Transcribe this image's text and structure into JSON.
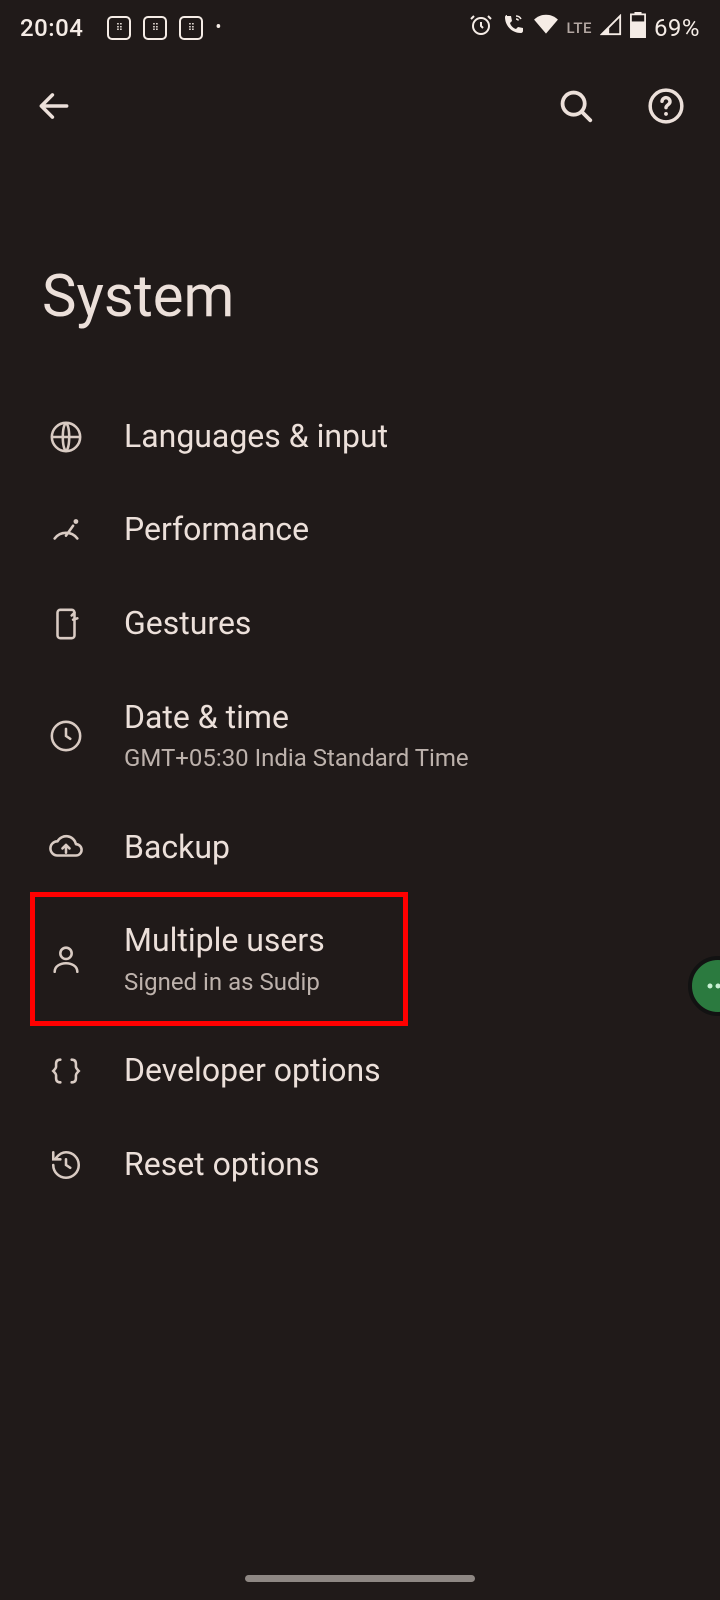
{
  "status": {
    "time": "20:04",
    "lte": "LTE",
    "battery_pct": "69%"
  },
  "header": {
    "title": "System"
  },
  "items": [
    {
      "id": "languages",
      "title": "Languages & input",
      "subtitle": ""
    },
    {
      "id": "performance",
      "title": "Performance",
      "subtitle": ""
    },
    {
      "id": "gestures",
      "title": "Gestures",
      "subtitle": ""
    },
    {
      "id": "datetime",
      "title": "Date & time",
      "subtitle": "GMT+05:30 India Standard Time"
    },
    {
      "id": "backup",
      "title": "Backup",
      "subtitle": ""
    },
    {
      "id": "users",
      "title": "Multiple users",
      "subtitle": "Signed in as Sudip",
      "highlighted": true
    },
    {
      "id": "dev",
      "title": "Developer options",
      "subtitle": ""
    },
    {
      "id": "reset",
      "title": "Reset options",
      "subtitle": ""
    }
  ]
}
